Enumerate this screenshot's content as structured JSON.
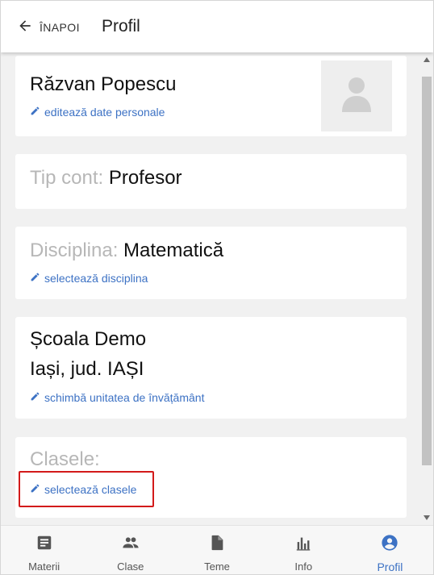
{
  "header": {
    "back_label": "ÎNAPOI",
    "title": "Profil"
  },
  "profile": {
    "name": "Răzvan Popescu",
    "edit_link": "editează date personale",
    "account_type_label": "Tip cont:",
    "account_type_value": "Profesor",
    "discipline_label": "Disciplina:",
    "discipline_value": "Matematică",
    "discipline_link": "selectează disciplina",
    "school_name": "Școala Demo",
    "school_location": "Iași, jud. IAȘI",
    "school_link": "schimbă unitatea de învățământ",
    "classes_label": "Clasele:",
    "classes_link": "selectează clasele"
  },
  "nav": {
    "items": [
      {
        "label": "Materii",
        "icon": "book-icon"
      },
      {
        "label": "Clase",
        "icon": "people-icon"
      },
      {
        "label": "Teme",
        "icon": "document-icon"
      },
      {
        "label": "Info",
        "icon": "bar-chart-icon"
      },
      {
        "label": "Profil",
        "icon": "account-circle-icon",
        "active": true
      }
    ]
  },
  "colors": {
    "accent": "#3d72c4",
    "highlight": "#d31a1a",
    "muted": "#b7b7b7"
  }
}
